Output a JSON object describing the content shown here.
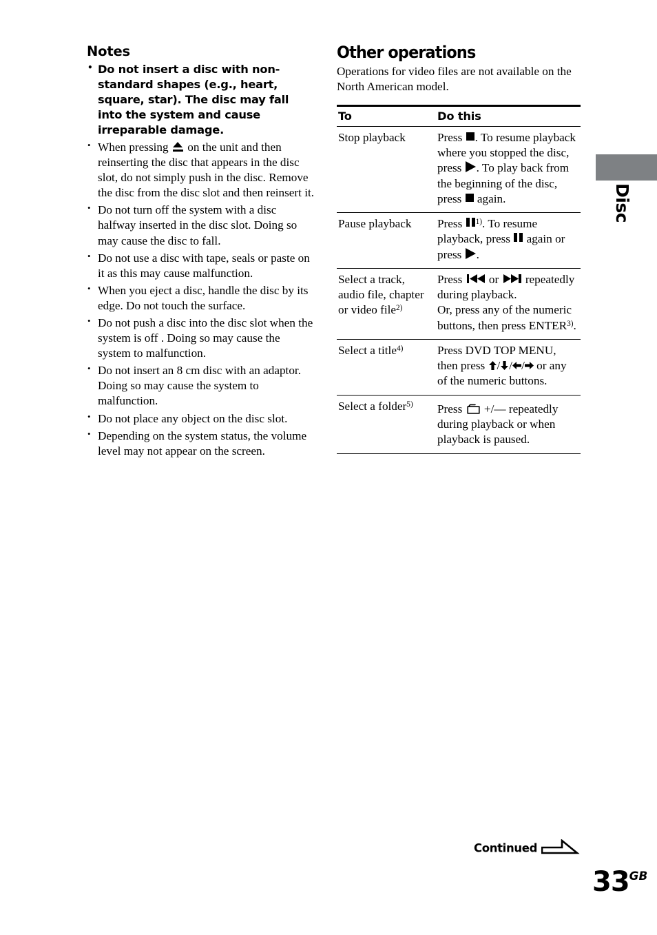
{
  "page": {
    "number": "33",
    "region_suffix": "GB",
    "continued_label": "Continued",
    "side_tab_label": "Disc",
    "tab_color": "#7e8184"
  },
  "notes": {
    "heading": "Notes",
    "items": [
      {
        "bold": true,
        "text": "Do not insert a disc with non-standard shapes (e.g., heart, square, star). The disc may fall into the system and cause irreparable damage."
      },
      {
        "bold": false,
        "prefix": "When pressing ",
        "icon": "eject-icon",
        "suffix": " on the unit and then reinserting the disc that appears in the disc slot, do not simply push in the disc. Remove the disc from the disc slot and then reinsert it."
      },
      {
        "bold": false,
        "text": "Do not turn off the system with a disc halfway inserted in the disc slot. Doing so may cause the disc to fall."
      },
      {
        "bold": false,
        "text": "Do not use a disc with tape, seals or paste on it as this may cause malfunction."
      },
      {
        "bold": false,
        "text": "When you eject a disc, handle the disc by its edge. Do not touch the surface."
      },
      {
        "bold": false,
        "text": "Do not push a disc into the disc slot when the system is off . Doing so may cause the system to malfunction."
      },
      {
        "bold": false,
        "text": "Do not insert an 8 cm disc with an adaptor. Doing so may cause the system to malfunction."
      },
      {
        "bold": false,
        "text": "Do not place any object on the disc slot."
      },
      {
        "bold": false,
        "text": "Depending on the system status, the volume level may not appear on the screen."
      }
    ]
  },
  "other_operations": {
    "heading": "Other operations",
    "intro": "Operations for video files are not available on the North American model.",
    "table": {
      "headers": [
        "To",
        "Do this"
      ],
      "rows": [
        {
          "to": "Stop playback",
          "to_sup": "",
          "do_parts": [
            {
              "t": "text",
              "v": "Press "
            },
            {
              "t": "icon",
              "v": "stop-icon"
            },
            {
              "t": "text",
              "v": ". To resume playback where you stopped the disc, press "
            },
            {
              "t": "icon",
              "v": "play-icon"
            },
            {
              "t": "text",
              "v": ". To play back from the beginning of the disc, press "
            },
            {
              "t": "icon",
              "v": "stop-icon"
            },
            {
              "t": "text",
              "v": " again."
            }
          ]
        },
        {
          "to": "Pause playback",
          "to_sup": "",
          "do_parts": [
            {
              "t": "text",
              "v": "Press "
            },
            {
              "t": "icon",
              "v": "pause-icon"
            },
            {
              "t": "sup",
              "v": "1)"
            },
            {
              "t": "text",
              "v": ". To resume playback, press "
            },
            {
              "t": "icon",
              "v": "pause-icon"
            },
            {
              "t": "text",
              "v": " again or press "
            },
            {
              "t": "icon",
              "v": "play-icon"
            },
            {
              "t": "text",
              "v": "."
            }
          ]
        },
        {
          "to": "Select a track, audio file, chapter or video file",
          "to_sup": "2)",
          "do_parts": [
            {
              "t": "text",
              "v": "Press "
            },
            {
              "t": "icon",
              "v": "previous-icon"
            },
            {
              "t": "text",
              "v": " or "
            },
            {
              "t": "icon",
              "v": "next-icon"
            },
            {
              "t": "text",
              "v": " repeatedly during playback."
            },
            {
              "t": "break",
              "v": ""
            },
            {
              "t": "text",
              "v": "Or, press any of the numeric buttons, then press ENTER"
            },
            {
              "t": "sup",
              "v": "3)"
            },
            {
              "t": "text",
              "v": "."
            }
          ]
        },
        {
          "to": "Select a title",
          "to_sup": "4)",
          "do_parts": [
            {
              "t": "text",
              "v": "Press DVD TOP MENU, then press "
            },
            {
              "t": "icon",
              "v": "arrow-up-icon"
            },
            {
              "t": "text",
              "v": "/"
            },
            {
              "t": "icon",
              "v": "arrow-down-icon"
            },
            {
              "t": "text",
              "v": "/"
            },
            {
              "t": "icon",
              "v": "arrow-left-icon"
            },
            {
              "t": "text",
              "v": "/"
            },
            {
              "t": "icon",
              "v": "arrow-right-icon"
            },
            {
              "t": "text",
              "v": " or any of the numeric buttons."
            }
          ]
        },
        {
          "to": "Select a folder",
          "to_sup": "5)",
          "do_parts": [
            {
              "t": "text",
              "v": "Press "
            },
            {
              "t": "icon",
              "v": "folder-icon"
            },
            {
              "t": "text",
              "v": " +/— repeatedly during playback or when playback is paused."
            }
          ]
        }
      ]
    }
  }
}
